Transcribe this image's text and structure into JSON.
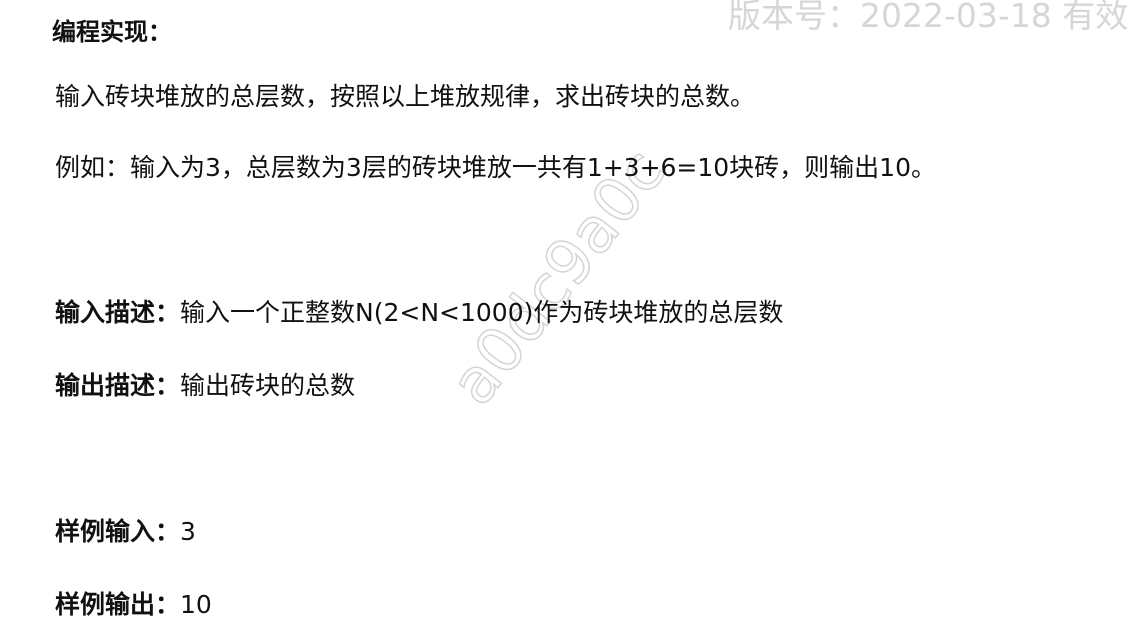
{
  "title": "编程实现：",
  "paragraph1": "输入砖块堆放的总层数，按照以上堆放规律，求出砖块的总数。",
  "paragraph2": "例如：输入为3，总层数为3层的砖块堆放一共有1+3+6=10块砖，则输出10。",
  "input_desc": {
    "label": "输入描述：",
    "text": "输入一个正整数N(2<N<1000)作为砖块堆放的总层数"
  },
  "output_desc": {
    "label": "输出描述：",
    "text": "输出砖块的总数"
  },
  "sample_input": {
    "label": "样例输入：",
    "value": "3"
  },
  "sample_output": {
    "label": "样例输出：",
    "value": "10"
  },
  "watermark_top": "版本号：2022-03-18 有效",
  "watermark_diagonal": "a0dc9a0c"
}
